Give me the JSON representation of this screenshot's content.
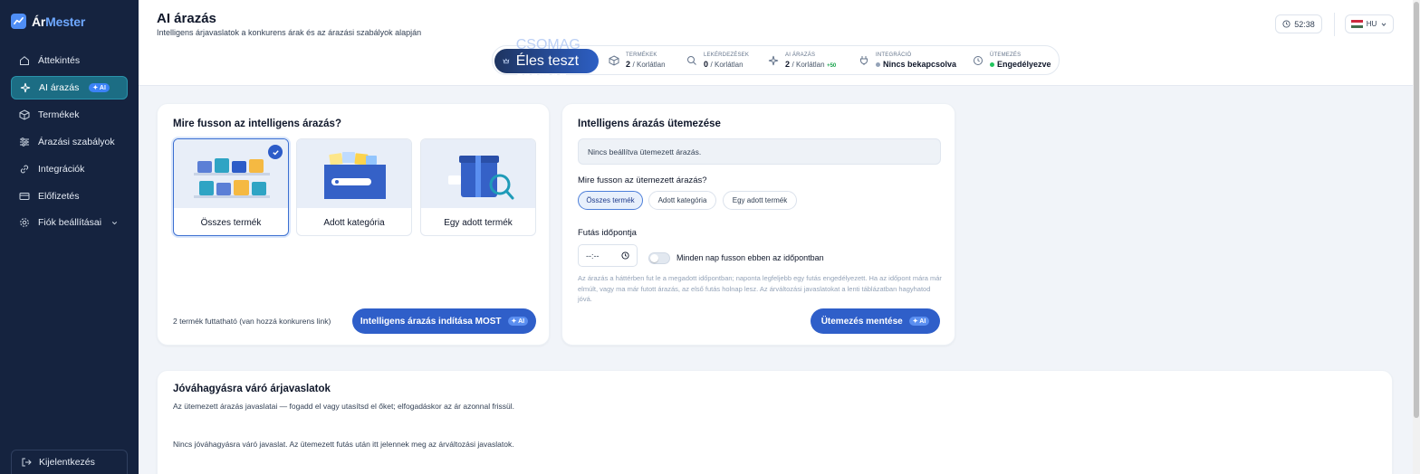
{
  "brand": {
    "part1": "Ár",
    "part2": "Mester"
  },
  "sidebar": {
    "items": [
      {
        "label": "Áttekintés"
      },
      {
        "label": "AI árazás",
        "badge": "AI"
      },
      {
        "label": "Termékek"
      },
      {
        "label": "Árazási szabályok"
      },
      {
        "label": "Integrációk"
      },
      {
        "label": "Előfizetés"
      },
      {
        "label": "Fiók beállításai"
      }
    ],
    "logout": "Kijelentkezés"
  },
  "header": {
    "title": "AI árazás",
    "subtitle": "Intelligens árjavaslatok a konkurens árak és az árazási szabályok alapján",
    "timer": "52:38",
    "lang": "HU"
  },
  "stats": {
    "package": {
      "label": "CSOMAG",
      "value": "Éles teszt csomag"
    },
    "products": {
      "label": "TERMÉKEK",
      "value": "2",
      "limit": "/ Korlátlan"
    },
    "queries": {
      "label": "LEKÉRDEZÉSEK",
      "value": "0",
      "limit": "/ Korlátlan"
    },
    "ai_pricing": {
      "label": "AI ÁRAZÁS",
      "value": "2",
      "limit": "/ Korlátlan",
      "extra": "+50"
    },
    "integration": {
      "label": "INTEGRÁCIÓ",
      "value": "Nincs bekapcsolva",
      "color": "#94a3b8"
    },
    "schedule": {
      "label": "ÜTEMEZÉS",
      "value": "Engedélyezve",
      "color": "#22c55e"
    }
  },
  "run_card": {
    "title": "Mire fusson az intelligens árazás?",
    "options": [
      {
        "label": "Összes termék",
        "selected": true
      },
      {
        "label": "Adott kategória",
        "selected": false
      },
      {
        "label": "Egy adott termék",
        "selected": false
      }
    ],
    "note": "2 termék futtatható (van hozzá konkurens link)",
    "button": "Intelligens árazás indítása MOST",
    "button_badge": "AI"
  },
  "schedule_card": {
    "title": "Intelligens árazás ütemezése",
    "info": "Nincs beállítva ütemezett árazás.",
    "scope_label": "Mire fusson az ütemezett árazás?",
    "chips": [
      {
        "label": "Összes termék",
        "selected": true
      },
      {
        "label": "Adott kategória",
        "selected": false
      },
      {
        "label": "Egy adott termék",
        "selected": false
      }
    ],
    "time_label": "Futás időpontja",
    "time_value": "--:--",
    "toggle_label": "Minden nap fusson ebben az időpontban",
    "help": "Az árazás a háttérben fut le a megadott időpontban; naponta legfeljebb egy futás engedélyezett. Ha az időpont mára már elmúlt, vagy ma már futott árazás, az első futás holnap lesz. Az árváltozási javaslatokat a lenti táblázatban hagyhatod jóvá.",
    "button": "Ütemezés mentése",
    "button_badge": "AI"
  },
  "approval": {
    "title": "Jóváhagyásra váró árjavaslatok",
    "subtitle": "Az ütemezett árazás javaslatai — fogadd el vagy utasítsd el őket; elfogadáskor az ár azonnal frissül.",
    "empty": "Nincs jóváhagyásra váró javaslat. Az ütemezett futás után itt jelennek meg az árváltozási javaslatok."
  },
  "colors": {
    "sidebar": "#15233f",
    "accent": "#2f5fc9",
    "active_nav": "#1c6d84"
  }
}
